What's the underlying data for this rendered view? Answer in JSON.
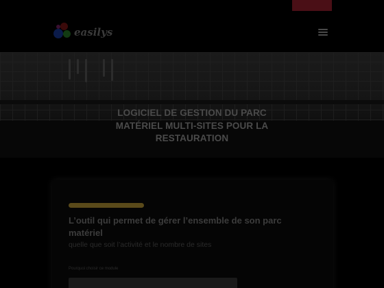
{
  "topbar": {
    "links": [
      "",
      "",
      "",
      ""
    ],
    "cta_label": ""
  },
  "header": {
    "logo_text": "easilys"
  },
  "hero": {
    "title": "LOGICIEL DE GESTION DU PARC MATÉRIEL MULTI-SITES POUR LA RESTAURATION"
  },
  "card": {
    "badge": "",
    "headline": "L’outil qui permet de gérer l’ensemble de son parc matériel",
    "subline": "quelle que soit l’activité et le nombre de sites",
    "field_label": "Pourquoi choisir ce module",
    "field_placeholder": ""
  },
  "colors": {
    "background": "#000000",
    "cta": "#4a0f16",
    "badge": "#5a4a1a"
  }
}
